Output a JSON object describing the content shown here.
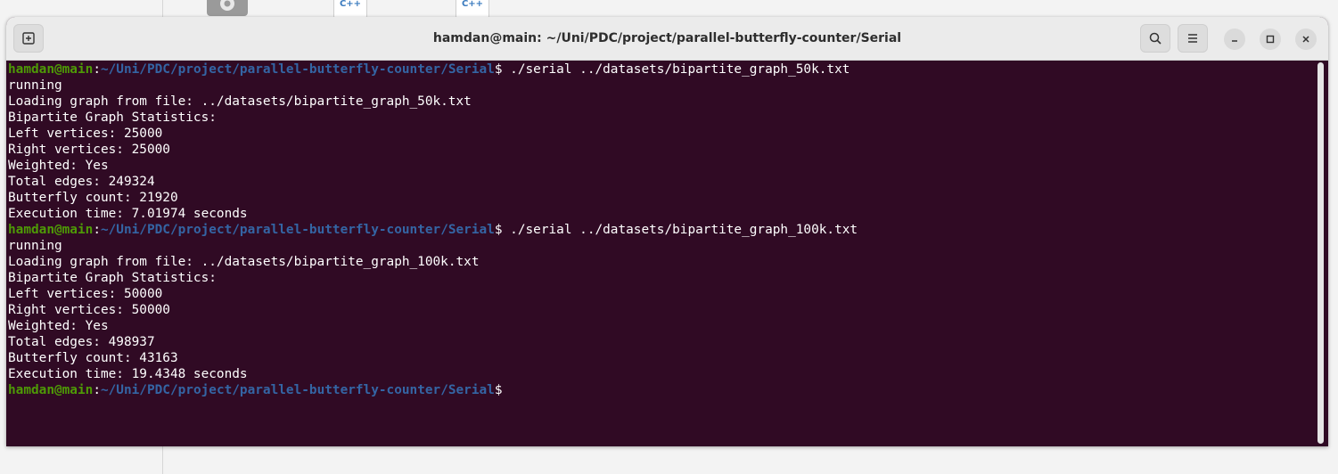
{
  "window": {
    "title": "hamdan@main: ~/Uni/PDC/project/parallel-butterfly-counter/Serial"
  },
  "desktop": {
    "icons": [
      {
        "name": "gear-icon"
      },
      {
        "name": "cpp-file-icon",
        "label": "C++"
      },
      {
        "name": "cpp-file-icon",
        "label": "C++"
      }
    ]
  },
  "headerbar": {
    "new_tab_icon": "new-tab-icon",
    "search_icon": "search-icon",
    "menu_icon": "hamburger-menu-icon",
    "minimize_icon": "minimize-icon",
    "maximize_icon": "maximize-icon",
    "close_icon": "close-icon"
  },
  "colors": {
    "terminal_bg": "#300a24",
    "prompt_user": "#4e9a06",
    "prompt_path": "#3465a4",
    "text": "#ffffff"
  },
  "terminal": {
    "prompt": {
      "user_host": "hamdan@main",
      "colon": ":",
      "path": "~/Uni/PDC/project/parallel-butterfly-counter/Serial",
      "dollar": "$"
    },
    "lines": [
      {
        "type": "prompt",
        "command": " ./serial ../datasets/bipartite_graph_50k.txt"
      },
      {
        "type": "output",
        "text": "running"
      },
      {
        "type": "output",
        "text": "Loading graph from file: ../datasets/bipartite_graph_50k.txt"
      },
      {
        "type": "output",
        "text": "Bipartite Graph Statistics:"
      },
      {
        "type": "output",
        "text": "Left vertices: 25000"
      },
      {
        "type": "output",
        "text": "Right vertices: 25000"
      },
      {
        "type": "output",
        "text": "Weighted: Yes"
      },
      {
        "type": "output",
        "text": "Total edges: 249324"
      },
      {
        "type": "output",
        "text": "Butterfly count: 21920"
      },
      {
        "type": "output",
        "text": "Execution time: 7.01974 seconds"
      },
      {
        "type": "prompt",
        "command": " ./serial ../datasets/bipartite_graph_100k.txt"
      },
      {
        "type": "output",
        "text": "running"
      },
      {
        "type": "output",
        "text": "Loading graph from file: ../datasets/bipartite_graph_100k.txt"
      },
      {
        "type": "output",
        "text": "Bipartite Graph Statistics:"
      },
      {
        "type": "output",
        "text": "Left vertices: 50000"
      },
      {
        "type": "output",
        "text": "Right vertices: 50000"
      },
      {
        "type": "output",
        "text": "Weighted: Yes"
      },
      {
        "type": "output",
        "text": "Total edges: 498937"
      },
      {
        "type": "output",
        "text": "Butterfly count: 43163"
      },
      {
        "type": "output",
        "text": "Execution time: 19.4348 seconds"
      },
      {
        "type": "prompt",
        "command": ""
      }
    ]
  }
}
